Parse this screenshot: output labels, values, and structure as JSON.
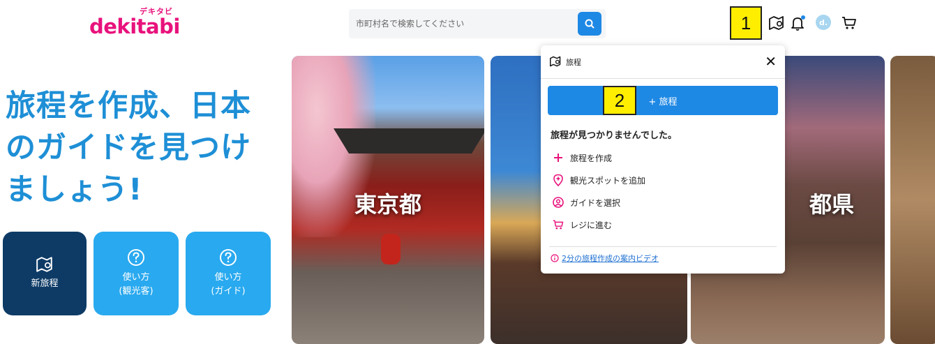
{
  "header": {
    "logo_kana": "デキタビ",
    "logo_text": "dekitabi",
    "search_placeholder": "市町村名で検索してください",
    "avatar_initial": "d."
  },
  "annotations": {
    "marker1": "1",
    "marker2": "2"
  },
  "hero": {
    "title_line1": "旅程を作成、日本",
    "title_line2": "のガイドを見つけ",
    "title_line3": "ましょう!"
  },
  "tiles": {
    "new_itinerary": "新旅程",
    "howto_tourist_line1": "使い方",
    "howto_tourist_line2": "(観光客)",
    "howto_guide_line1": "使い方",
    "howto_guide_line2": "(ガイド)"
  },
  "cards": {
    "tokyo": "東京都",
    "kyoto_partial": "都県"
  },
  "popup": {
    "title": "旅程",
    "close": "✕",
    "add_button": "+ 旅程",
    "empty_message": "旅程が見つかりませんでした。",
    "steps": [
      "旅程を作成",
      "観光スポットを追加",
      "ガイドを選択",
      "レジに進む"
    ],
    "video_link": "2分の旅程作成の案内ビデオ"
  },
  "colors": {
    "brand": "#e8127c",
    "accent": "#1e88e5",
    "hero_title": "#1e8fd6",
    "tile_dark": "#0d3b66",
    "tile_light": "#29a9ef",
    "step_icon": "#e8127c"
  }
}
